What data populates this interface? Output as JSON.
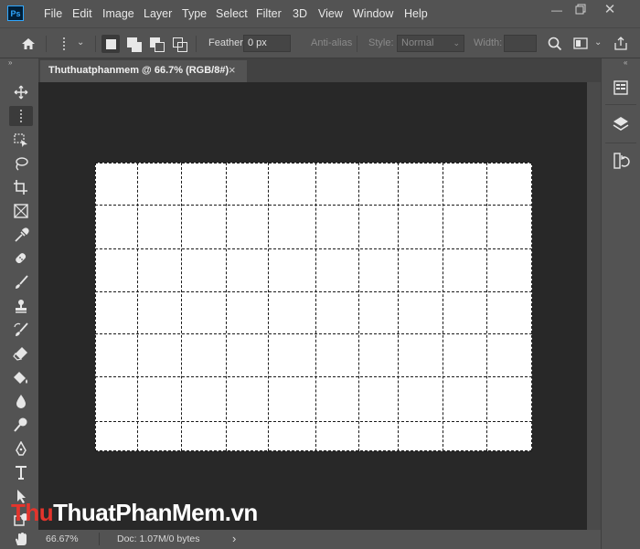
{
  "app": {
    "logo_text": "Ps"
  },
  "menu": [
    "File",
    "Edit",
    "Image",
    "Layer",
    "Type",
    "Select",
    "Filter",
    "3D",
    "View",
    "Window",
    "Help"
  ],
  "options_bar": {
    "feather_label": "Feather:",
    "feather_value": "0 px",
    "antialias_label": "Anti-alias",
    "style_label": "Style:",
    "style_value": "Normal",
    "width_label": "Width:",
    "width_value": ""
  },
  "document": {
    "tab_title": "Thuthuatphanmem @ 66.7% (RGB/8#)",
    "close_glyph": "×"
  },
  "status": {
    "zoom": "66.67%",
    "doc_info": "Doc: 1.07M/0 bytes",
    "arrow": "›"
  },
  "watermark": {
    "part1": "Thu",
    "part2": "ThuatPhanMem.vn"
  },
  "tools": [
    "move-tool",
    "single-column-marquee-tool",
    "object-selection-tool",
    "lasso-tool",
    "crop-tool",
    "frame-tool",
    "eyedropper-tool",
    "healing-brush-tool",
    "brush-tool",
    "clone-stamp-tool",
    "history-brush-tool",
    "eraser-tool",
    "paint-bucket-tool",
    "blur-tool",
    "dodge-tool",
    "pen-tool",
    "type-tool",
    "path-selection-tool",
    "shape-tool",
    "hand-tool"
  ],
  "right_panels": [
    "properties-icon",
    "layers-icon",
    "history-icon"
  ],
  "colors": {
    "canvas": "#ffffff",
    "pasteboard": "#282828",
    "ui": "#535353",
    "watermark_red": "#e4342c"
  }
}
